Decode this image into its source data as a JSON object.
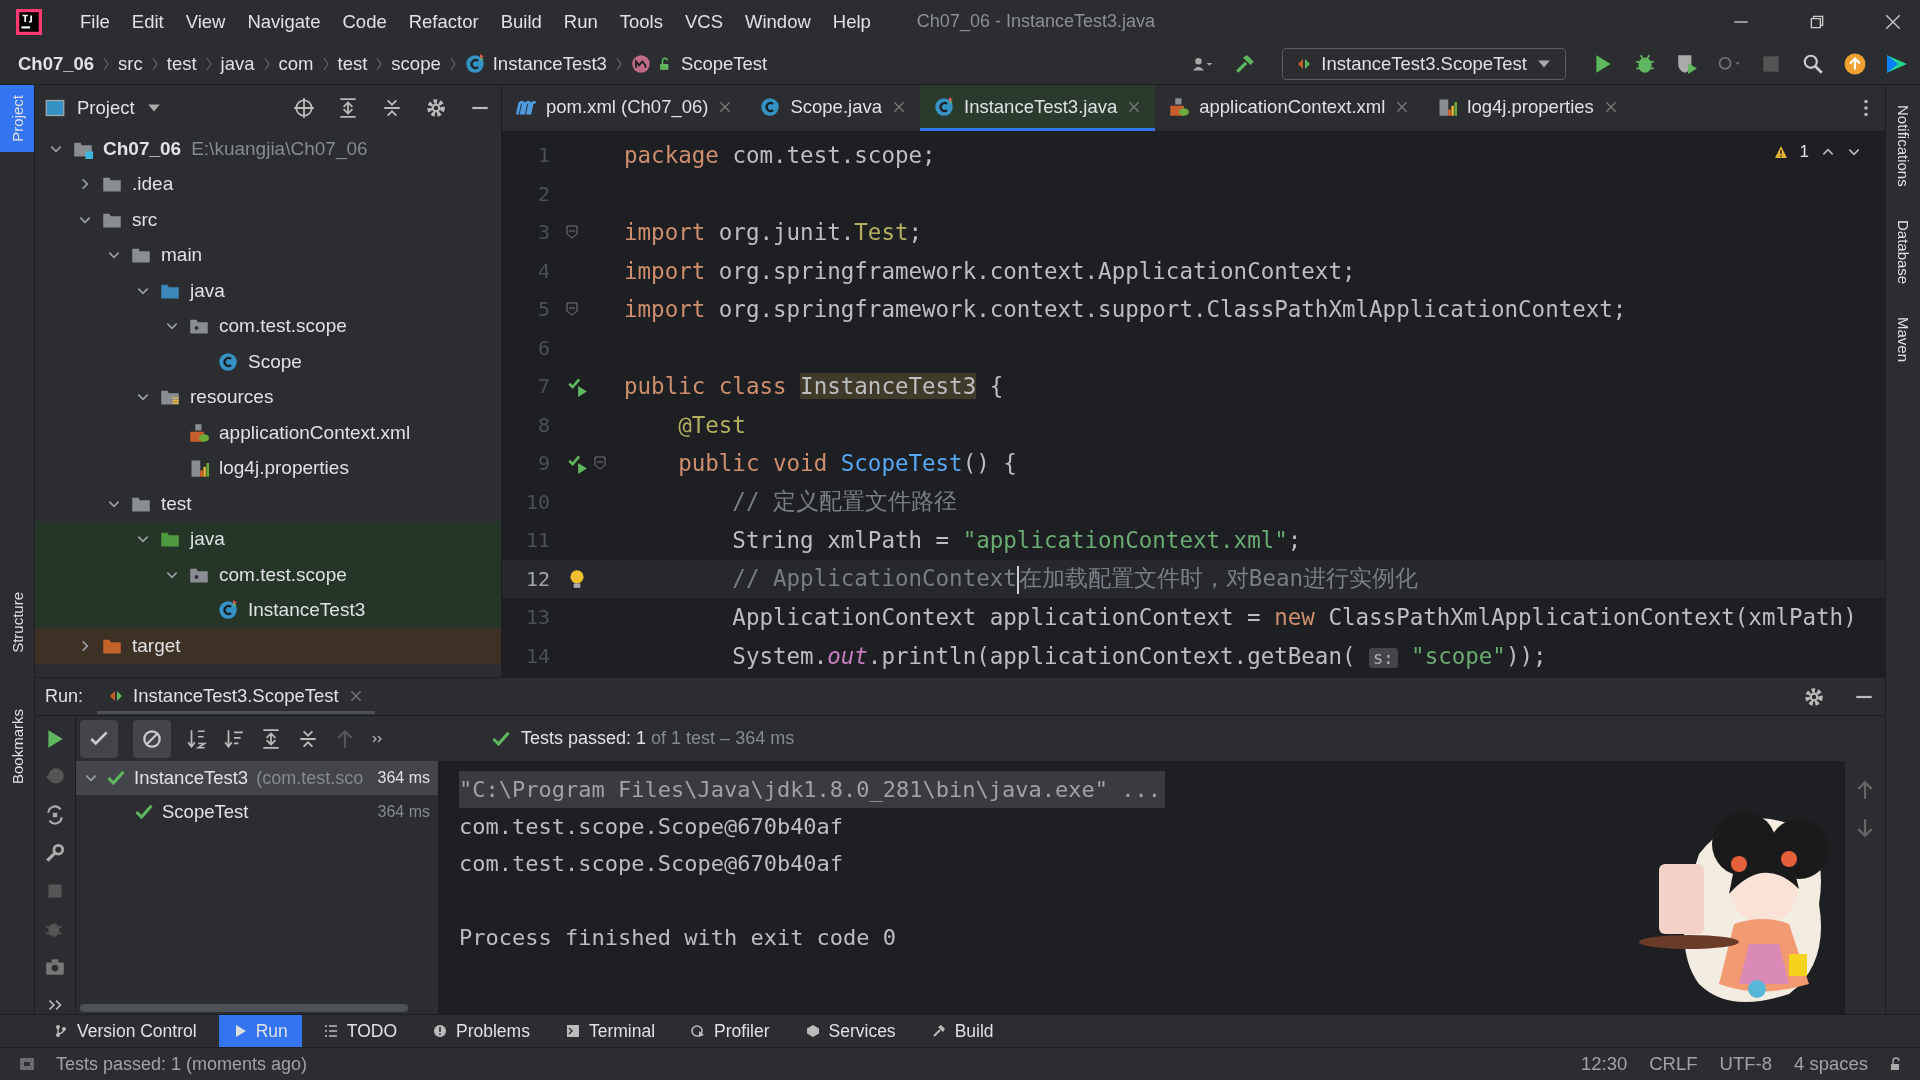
{
  "window": {
    "title": "Ch07_06 - InstanceTest3.java"
  },
  "menu": [
    "File",
    "Edit",
    "View",
    "Navigate",
    "Code",
    "Refactor",
    "Build",
    "Run",
    "Tools",
    "VCS",
    "Window",
    "Help"
  ],
  "breadcrumbs": [
    {
      "label": "Ch07_06",
      "kind": "project"
    },
    {
      "label": "src",
      "kind": "folder"
    },
    {
      "label": "test",
      "kind": "folder"
    },
    {
      "label": "java",
      "kind": "folder"
    },
    {
      "label": "com",
      "kind": "folder"
    },
    {
      "label": "test",
      "kind": "folder"
    },
    {
      "label": "scope",
      "kind": "folder"
    },
    {
      "label": "InstanceTest3",
      "kind": "test-class"
    },
    {
      "label": "ScopeTest",
      "kind": "method"
    }
  ],
  "run_config": "InstanceTest3.ScopeTest",
  "left_tool_windows": [
    {
      "label": "Project",
      "selected": true
    },
    {
      "label": "Structure",
      "selected": false
    },
    {
      "label": "Bookmarks",
      "selected": false
    }
  ],
  "right_tool_windows": [
    "Notifications",
    "Database",
    "Maven"
  ],
  "project_panel": {
    "title": "Project",
    "tree": [
      {
        "label": "Ch07_06",
        "path": "E:\\kuangjia\\Ch07_06",
        "kind": "module",
        "expanded": true,
        "children": [
          {
            "label": ".idea",
            "kind": "folder",
            "expanded": false
          },
          {
            "label": "src",
            "kind": "folder",
            "expanded": true,
            "children": [
              {
                "label": "main",
                "kind": "folder",
                "expanded": true,
                "children": [
                  {
                    "label": "java",
                    "kind": "source-folder",
                    "expanded": true,
                    "children": [
                      {
                        "label": "com.test.scope",
                        "kind": "package",
                        "expanded": true,
                        "children": [
                          {
                            "label": "Scope",
                            "kind": "class"
                          }
                        ]
                      }
                    ]
                  },
                  {
                    "label": "resources",
                    "kind": "resources-folder",
                    "expanded": true,
                    "children": [
                      {
                        "label": "applicationContext.xml",
                        "kind": "xml"
                      },
                      {
                        "label": "log4j.properties",
                        "kind": "properties"
                      }
                    ]
                  }
                ]
              },
              {
                "label": "test",
                "kind": "folder",
                "expanded": true,
                "children": [
                  {
                    "label": "java",
                    "kind": "test-folder",
                    "expanded": true,
                    "test_source": true,
                    "children": [
                      {
                        "label": "com.test.scope",
                        "kind": "package",
                        "expanded": true,
                        "test_source": true,
                        "children": [
                          {
                            "label": "InstanceTest3",
                            "kind": "test-class",
                            "test_source": true
                          }
                        ]
                      }
                    ]
                  }
                ]
              }
            ]
          },
          {
            "label": "target",
            "kind": "excluded-folder",
            "expanded": false,
            "excluded": true
          }
        ]
      }
    ]
  },
  "editor": {
    "tabs": [
      {
        "label": "pom.xml (Ch07_06)",
        "kind": "maven",
        "selected": false
      },
      {
        "label": "Scope.java",
        "kind": "class",
        "selected": false
      },
      {
        "label": "InstanceTest3.java",
        "kind": "test-class",
        "selected": true
      },
      {
        "label": "applicationContext.xml",
        "kind": "xml",
        "selected": false
      },
      {
        "label": "log4j.properties",
        "kind": "properties",
        "selected": false
      }
    ],
    "warnings": "1",
    "lines": [
      {
        "number": "1",
        "current": false,
        "tokens": [
          {
            "kind": "keyword",
            "text": "package "
          },
          {
            "kind": "plain",
            "text": "com.test.scope;"
          }
        ]
      },
      {
        "number": "2",
        "current": false
      },
      {
        "number": "3",
        "current": false,
        "fold_marker": true,
        "tokens": [
          {
            "kind": "keyword",
            "text": "import "
          },
          {
            "kind": "plain",
            "text": "org.junit."
          },
          {
            "kind": "annotation",
            "text": "Test"
          },
          {
            "kind": "plain",
            "text": ";"
          }
        ]
      },
      {
        "number": "4",
        "current": false,
        "tokens": [
          {
            "kind": "keyword",
            "text": "import "
          },
          {
            "kind": "plain",
            "text": "org.springframework.context.ApplicationContext;"
          }
        ]
      },
      {
        "number": "5",
        "current": false,
        "fold_marker": true,
        "tokens": [
          {
            "kind": "keyword",
            "text": "import "
          },
          {
            "kind": "plain",
            "text": "org.springframework.context.support.ClassPathXmlApplicationContext;"
          }
        ]
      },
      {
        "number": "6",
        "current": false
      },
      {
        "number": "7",
        "current": false,
        "run_marker": true,
        "tokens": [
          {
            "kind": "keyword",
            "text": "public class "
          },
          {
            "kind": "highlight",
            "text": "InstanceTest3"
          },
          {
            "kind": "plain",
            "text": " {"
          }
        ]
      },
      {
        "number": "8",
        "current": false,
        "tokens": [
          {
            "kind": "annotation",
            "text": "    @Test"
          }
        ]
      },
      {
        "number": "9",
        "current": false,
        "run_marker": true,
        "fold_marker": true,
        "tokens": [
          {
            "kind": "keyword",
            "text": "    public void "
          },
          {
            "kind": "method",
            "text": "ScopeTest"
          },
          {
            "kind": "plain",
            "text": "() {"
          }
        ]
      },
      {
        "number": "10",
        "current": false,
        "tokens": [
          {
            "kind": "comment",
            "text": "        // 定义配置文件路径"
          }
        ]
      },
      {
        "number": "11",
        "current": false,
        "tokens": [
          {
            "kind": "plain",
            "text": "        String xmlPath = "
          },
          {
            "kind": "string",
            "text": "\"applicationContext.xml\""
          },
          {
            "kind": "plain",
            "text": ";"
          }
        ]
      },
      {
        "number": "12",
        "current": true,
        "bulb": true,
        "tokens": [
          {
            "kind": "comment",
            "text": "        // ApplicationContext",
            "caret_after": true
          },
          {
            "kind": "comment",
            "text": "在加载配置文件时，对Bean进行实例化"
          }
        ]
      },
      {
        "number": "13",
        "current": false,
        "tokens": [
          {
            "kind": "plain",
            "text": "        ApplicationContext applicationContext = "
          },
          {
            "kind": "keyword",
            "text": "new "
          },
          {
            "kind": "plain",
            "text": "ClassPathXmlApplicationContext(xmlPath)"
          }
        ]
      },
      {
        "number": "14",
        "current": false,
        "tokens": [
          {
            "kind": "plain",
            "text": "        System."
          },
          {
            "kind": "field",
            "text": "out"
          },
          {
            "kind": "plain",
            "text": ".println(applicationContext.getBean( "
          },
          {
            "kind": "hint",
            "text": "s:"
          },
          {
            "kind": "string",
            "text": " \"scope\""
          },
          {
            "kind": "plain",
            "text": "));"
          }
        ]
      }
    ]
  },
  "run_panel": {
    "label": "Run:",
    "tab": "InstanceTest3.ScopeTest",
    "filters": [
      {
        "kind": "passed",
        "selected": true
      },
      {
        "kind": "ignored",
        "selected": true
      }
    ],
    "summary": {
      "status": "Tests passed: ",
      "count": "1",
      "rest": " of 1 test – 364 ms"
    },
    "tests": [
      {
        "label": "InstanceTest3",
        "detail": "(com.test.sco",
        "time": "364 ms",
        "passed": true,
        "selected": true,
        "expanded": true,
        "children": [
          {
            "label": "ScopeTest",
            "time": "364 ms",
            "passed": true,
            "selected": false
          }
        ]
      }
    ],
    "console": [
      {
        "kind": "command",
        "text": "\"C:\\Program Files\\Java\\jdk1.8.0_281\\bin\\java.exe\" ..."
      },
      {
        "kind": "output",
        "text": "com.test.scope.Scope@670b40af"
      },
      {
        "kind": "output",
        "text": "com.test.scope.Scope@670b40af"
      },
      {
        "kind": "blank"
      },
      {
        "kind": "output",
        "text": "Process finished with exit code 0"
      }
    ]
  },
  "bottom_tabs": [
    {
      "label": "Version Control",
      "kind": "vcs",
      "selected": false
    },
    {
      "label": "Run",
      "kind": "run",
      "selected": true
    },
    {
      "label": "TODO",
      "kind": "todo",
      "selected": false
    },
    {
      "label": "Problems",
      "kind": "problems",
      "selected": false
    },
    {
      "label": "Terminal",
      "kind": "terminal",
      "selected": false
    },
    {
      "label": "Profiler",
      "kind": "profiler",
      "selected": false
    },
    {
      "label": "Services",
      "kind": "services",
      "selected": false
    },
    {
      "label": "Build",
      "kind": "build",
      "selected": false
    }
  ],
  "status_bar": {
    "message": "Tests passed: 1 (moments ago)",
    "items": [
      "12:30",
      "CRLF",
      "UTF-8",
      "4 spaces"
    ]
  }
}
